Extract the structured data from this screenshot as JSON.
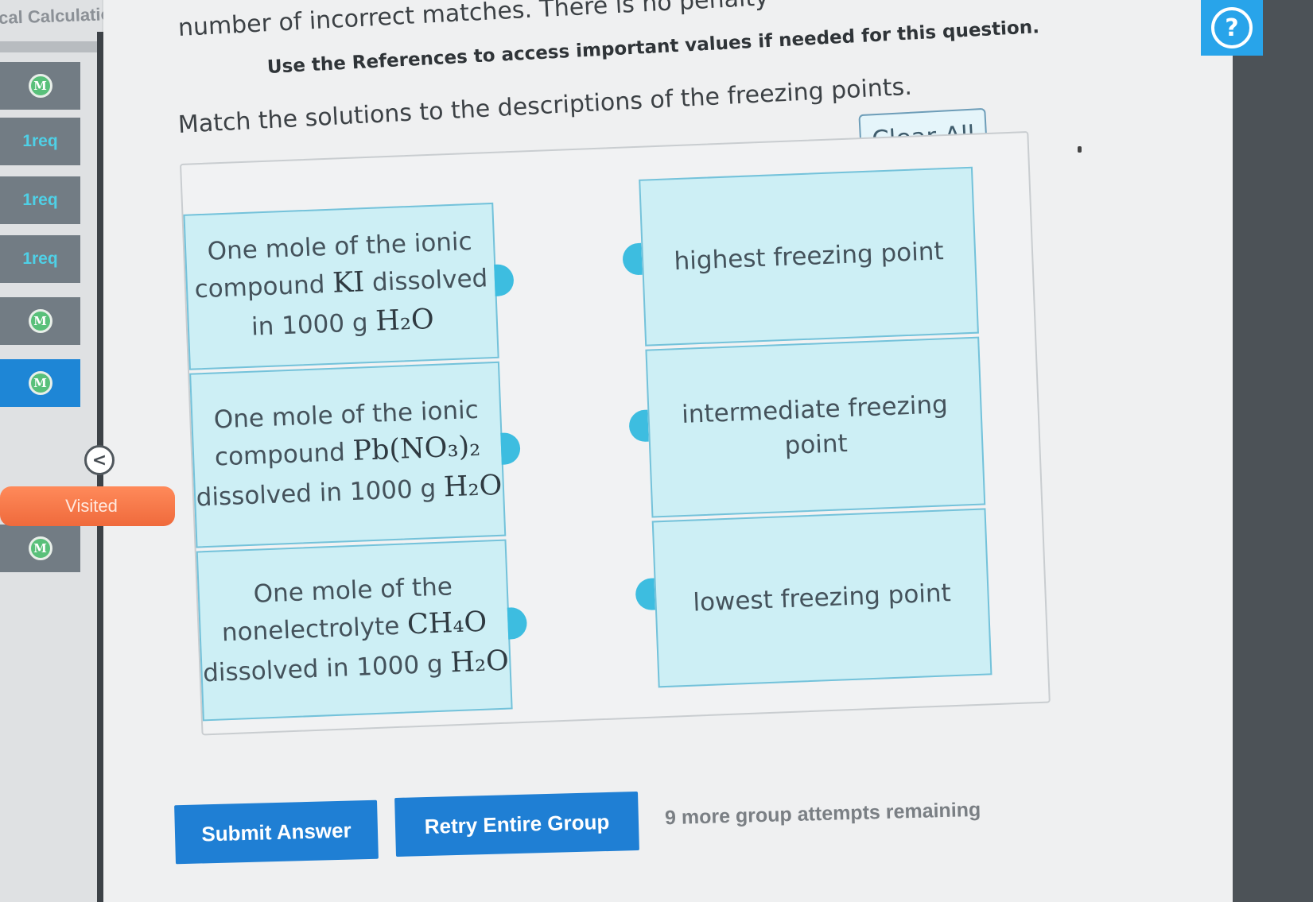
{
  "module_title": "ical Calculation...",
  "sidebar": {
    "items": [
      {
        "type": "badge",
        "label": "M"
      },
      {
        "type": "text",
        "label": "1req"
      },
      {
        "type": "text",
        "label": "1req"
      },
      {
        "type": "text",
        "label": "1req"
      },
      {
        "type": "badge",
        "label": "M"
      },
      {
        "type": "badge",
        "label": "M",
        "active": true
      },
      {
        "type": "badge",
        "label": "M"
      }
    ],
    "visited_label": "Visited",
    "collapse_label": "<"
  },
  "question": {
    "penalty_text": "number of incorrect matches. There is no penalty",
    "references_text": "Use the References to access important values if needed for this question.",
    "prompt_text": "Match the solutions to the descriptions of the freezing points.",
    "clear_all_label": "Clear All"
  },
  "solutions": [
    {
      "before": "One mole of the ionic compound ",
      "formula": "KI",
      "middle": " dissolved in 1000 g ",
      "water": "H₂O"
    },
    {
      "before": "One mole of the ionic compound ",
      "formula": "Pb(NO₃)₂",
      "middle": " dissolved in 1000 g ",
      "water": "H₂O"
    },
    {
      "before": "One mole of the nonelectrolyte ",
      "formula": "CH₄O",
      "middle": " dissolved in 1000 g ",
      "water": "H₂O"
    }
  ],
  "descriptions": [
    {
      "label": "highest freezing point"
    },
    {
      "label": "intermediate freezing point"
    },
    {
      "label": "lowest freezing point"
    }
  ],
  "actions": {
    "submit_label": "Submit Answer",
    "retry_label": "Retry Entire Group",
    "attempts_text": "9 more group attempts remaining"
  },
  "help_icon": "?",
  "colors": {
    "card_fill": "#cdeff5",
    "card_border": "#74c2da",
    "knob": "#3dbde0",
    "button_blue": "#1f7fd4",
    "visited_orange": "#ef6a3c",
    "sidebar_active": "#1e86d6",
    "badge_green": "#59c07a"
  }
}
